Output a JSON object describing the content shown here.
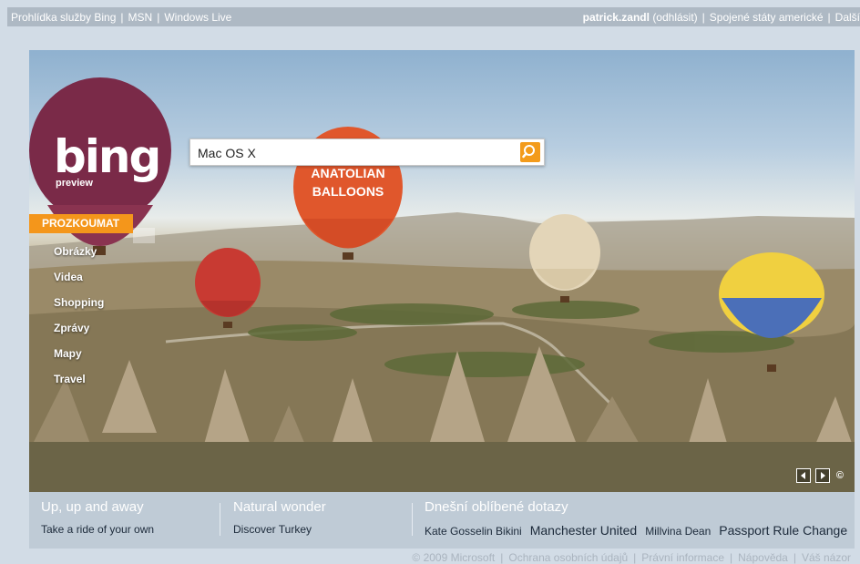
{
  "topbar": {
    "left_links": [
      "Prohlídka služby Bing",
      "MSN",
      "Windows Live"
    ],
    "user": "patrick.zandl",
    "logout": "(odhlásit)",
    "region": "Spojené státy americké",
    "more": "Další"
  },
  "logo": {
    "word": "bing",
    "sub": "preview"
  },
  "search": {
    "value": "Mac OS X"
  },
  "nav": {
    "header": "PROZKOUMAT",
    "items": [
      "Obrázky",
      "Videa",
      "Shopping",
      "Zprávy",
      "Mapy",
      "Travel"
    ]
  },
  "bottom": {
    "col1": {
      "title": "Up, up and away",
      "link": "Take a ride of your own"
    },
    "col2": {
      "title": "Natural wonder",
      "link": "Discover Turkey"
    },
    "col3": {
      "title": "Dnešní oblíbené dotazy",
      "queries": [
        "Kate Gosselin Bikini",
        "Manchester United",
        "Millvina Dean",
        "Passport Rule Change"
      ]
    }
  },
  "footer": {
    "copyright": "© 2009 Microsoft",
    "links": [
      "Ochrana osobních údajů",
      "Právní informace",
      "Nápověda",
      "Váš názor"
    ]
  },
  "balloon_texts": [
    "ANATOLIAN",
    "BALLOONS"
  ],
  "colors": {
    "accent": "#f4961b",
    "topbar": "#aeb9c4",
    "panel": "#bfcbd6"
  },
  "icons": [
    "search-icon",
    "prev-arrow-icon",
    "next-arrow-icon",
    "copyright-icon"
  ]
}
